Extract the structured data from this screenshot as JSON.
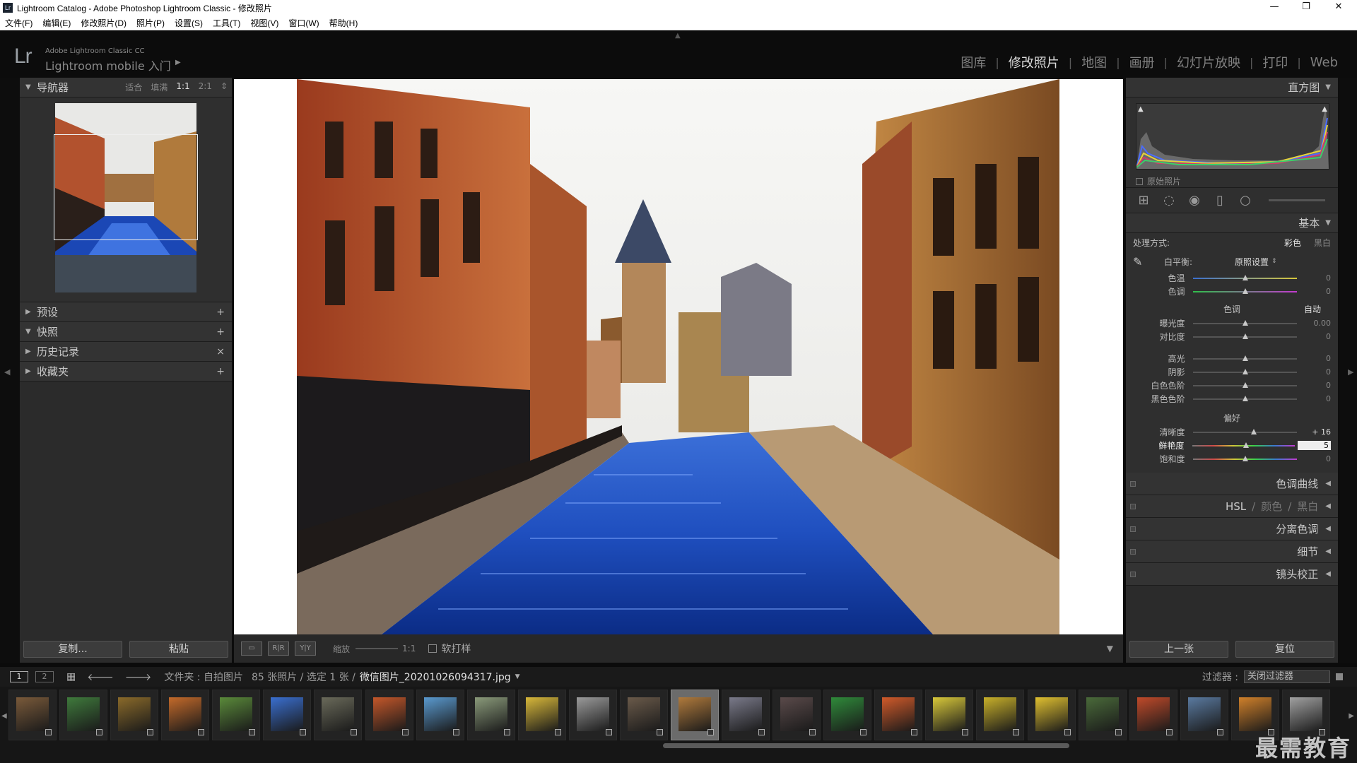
{
  "window": {
    "title": "Lightroom Catalog - Adobe Photoshop Lightroom Classic - 修改照片",
    "controls": [
      "—",
      "❐",
      "✕"
    ]
  },
  "menu": [
    "文件(F)",
    "编辑(E)",
    "修改照片(D)",
    "照片(P)",
    "设置(S)",
    "工具(T)",
    "视图(V)",
    "窗口(W)",
    "帮助(H)"
  ],
  "identity": {
    "logo": "Lr",
    "small": "Adobe Lightroom Classic CC",
    "big": "Lightroom mobile 入门",
    "arrow": "▶"
  },
  "modules": [
    "图库",
    "修改照片",
    "地图",
    "画册",
    "幻灯片放映",
    "打印",
    "Web"
  ],
  "active_module": "修改照片",
  "left": {
    "navigator": {
      "title": "导航器",
      "zoom": [
        "适合",
        "填满",
        "1:1",
        "2:1"
      ],
      "zoom_selected": "1:1"
    },
    "panels": [
      {
        "title": "预设",
        "action": "+"
      },
      {
        "title": "快照",
        "action": "+"
      },
      {
        "title": "历史记录",
        "action": "×"
      },
      {
        "title": "收藏夹",
        "action": "+"
      }
    ],
    "copy": "复制...",
    "paste": "粘贴"
  },
  "toolbar": {
    "zoom_label": "缩放",
    "zoom_value": "1:1",
    "softproof": "软打样"
  },
  "right": {
    "histogram": "直方图",
    "original": "原始照片",
    "basic": {
      "title": "基本",
      "treatment_label": "处理方式:",
      "treatment_color": "彩色",
      "treatment_bw": "黑白",
      "wb_label": "白平衡:",
      "wb_value": "原照设置",
      "temp": {
        "label": "色温",
        "value": "0",
        "pos": 0.5
      },
      "tint": {
        "label": "色调",
        "value": "0",
        "pos": 0.5
      },
      "tone_title": "色调",
      "auto": "自动",
      "exposure": {
        "label": "曝光度",
        "value": "0.00",
        "pos": 0.5
      },
      "contrast": {
        "label": "对比度",
        "value": "0",
        "pos": 0.5
      },
      "highlights": {
        "label": "高光",
        "value": "0",
        "pos": 0.5
      },
      "shadows": {
        "label": "阴影",
        "value": "0",
        "pos": 0.5
      },
      "whites": {
        "label": "白色色阶",
        "value": "0",
        "pos": 0.5
      },
      "blacks": {
        "label": "黑色色阶",
        "value": "0",
        "pos": 0.5
      },
      "presence_title": "偏好",
      "clarity": {
        "label": "清晰度",
        "value": "+ 16",
        "pos": 0.58
      },
      "vibrance": {
        "label": "鲜艳度",
        "value": "5",
        "pos": 0.52
      },
      "saturation": {
        "label": "饱和度",
        "value": "0",
        "pos": 0.5
      }
    },
    "collapsed": [
      {
        "parts": [
          "色调曲线"
        ]
      },
      {
        "parts": [
          "HSL",
          "/",
          "颜色",
          "/",
          "黑白"
        ]
      },
      {
        "parts": [
          "分离色调"
        ]
      },
      {
        "parts": [
          "细节"
        ]
      },
      {
        "parts": [
          "镜头校正"
        ]
      }
    ],
    "prev": "上一张",
    "reset": "复位"
  },
  "filmbar": {
    "screen1": "1",
    "screen2": "2",
    "folder": "文件夹 : 自拍图片",
    "count": "85 张照片 / 选定 1 张 /",
    "filename": "微信图片_20201026094317.jpg",
    "filter_label": "过滤器 :",
    "filter_value": "关闭过滤器"
  },
  "watermark": "最需教育",
  "colors": {
    "bg": "#0b0b0b",
    "panel": "#2b2b2b",
    "accent_water": "#1f4fbf"
  }
}
